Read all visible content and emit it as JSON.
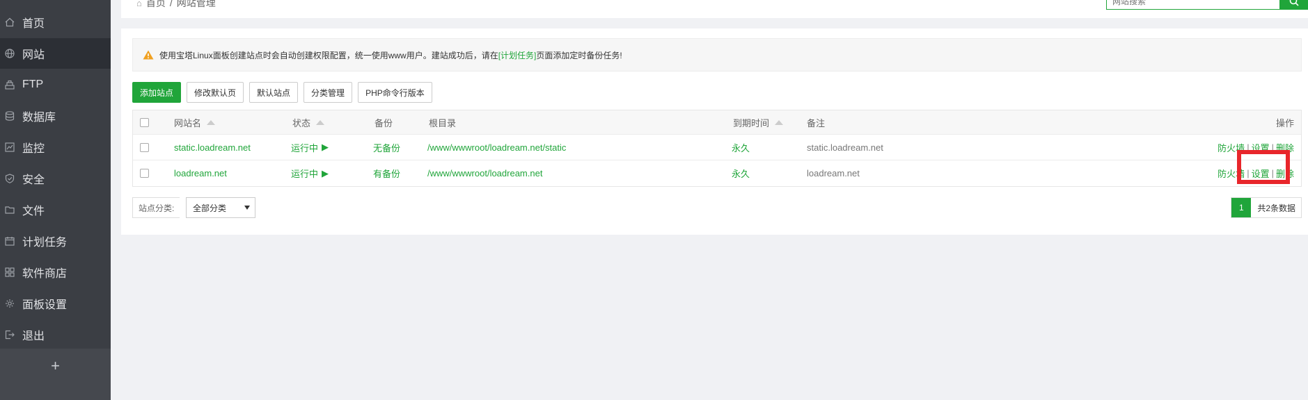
{
  "sidebar": {
    "items": [
      {
        "label": "首页",
        "icon": "home-icon",
        "active": false
      },
      {
        "label": "网站",
        "icon": "globe-icon",
        "active": true
      },
      {
        "label": "FTP",
        "icon": "ftp-icon",
        "active": false
      },
      {
        "label": "数据库",
        "icon": "database-icon",
        "active": false
      },
      {
        "label": "监控",
        "icon": "monitor-icon",
        "active": false
      },
      {
        "label": "安全",
        "icon": "shield-icon",
        "active": false
      },
      {
        "label": "文件",
        "icon": "folder-icon",
        "active": false
      },
      {
        "label": "计划任务",
        "icon": "calendar-icon",
        "active": false
      },
      {
        "label": "软件商店",
        "icon": "grid-icon",
        "active": false
      },
      {
        "label": "面板设置",
        "icon": "gear-icon",
        "active": false
      },
      {
        "label": "退出",
        "icon": "logout-icon",
        "active": false
      }
    ],
    "add_label": "+"
  },
  "header": {
    "breadcrumb": [
      "首页",
      "/",
      "网站管理"
    ],
    "search_placeholder": "网站搜索"
  },
  "notice": {
    "text_before": "使用宝塔Linux面板创建站点时会自动创建权限配置，统一使用www用户。建站成功后，请在",
    "link": "[计划任务]",
    "text_after": "页面添加定时备份任务!"
  },
  "toolbar": {
    "add_site": "添加站点",
    "edit_default_page": "修改默认页",
    "default_site": "默认站点",
    "category_manage": "分类管理",
    "php_cli": "PHP命令行版本"
  },
  "table": {
    "headers": {
      "name": "网站名",
      "status": "状态",
      "backup": "备份",
      "root": "根目录",
      "expire": "到期时间",
      "remark": "备注",
      "ops": "操作"
    },
    "rows": [
      {
        "name": "static.loadream.net",
        "status": "运行中",
        "status_icon": "▶",
        "backup": "无备份",
        "root": "/www/wwwroot/loadream.net/static",
        "expire": "永久",
        "remark": "static.loadream.net",
        "op_firewall": "防火墙",
        "op_settings": "设置",
        "op_delete": "删除"
      },
      {
        "name": "loadream.net",
        "status": "运行中",
        "status_icon": "▶",
        "backup": "有备份",
        "root": "/www/wwwroot/loadream.net",
        "expire": "永久",
        "remark": "loadream.net",
        "op_firewall": "防火墙",
        "op_settings": "设置",
        "op_delete": "删除"
      }
    ],
    "op_separator": "|"
  },
  "footer": {
    "category_label": "站点分类:",
    "category_value": "全部分类",
    "page_number": "1",
    "total_text": "共2条数据"
  },
  "colors": {
    "accent": "#20a53a",
    "sidebar_bg": "#3b3e44",
    "highlight": "#e8262b"
  }
}
